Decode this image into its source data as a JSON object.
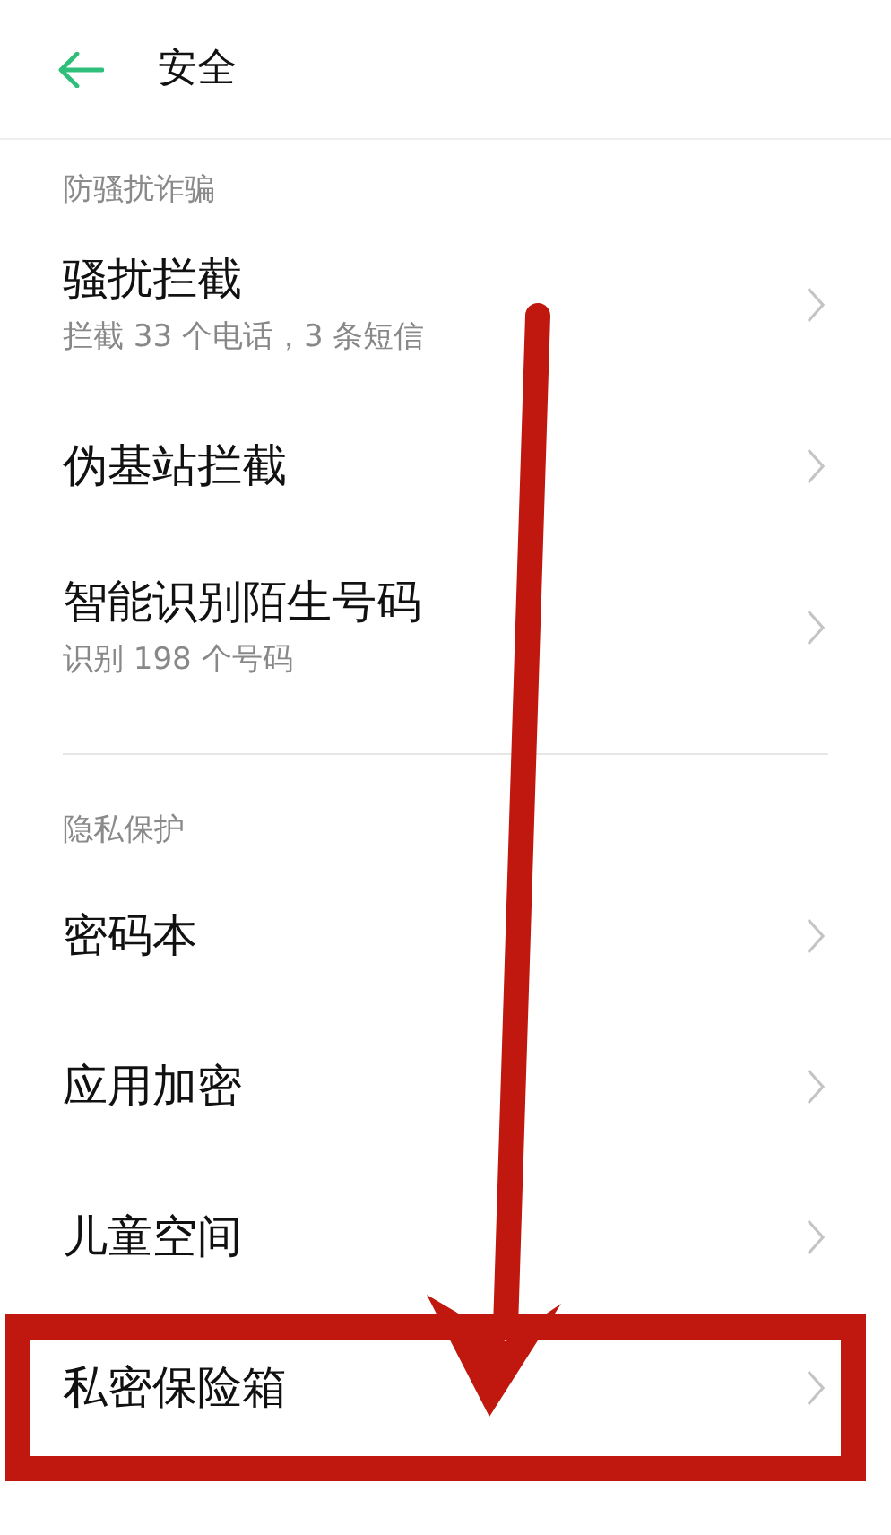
{
  "header": {
    "title": "安全"
  },
  "sections": [
    {
      "title": "防骚扰诈骗",
      "items": [
        {
          "label": "骚扰拦截",
          "subtitle": "拦截 33 个电话，3 条短信",
          "highlighted": false
        },
        {
          "label": "伪基站拦截",
          "highlighted": false
        },
        {
          "label": "智能识别陌生号码",
          "subtitle": "识别 198 个号码",
          "highlighted": false
        }
      ]
    },
    {
      "title": "隐私保护",
      "items": [
        {
          "label": "密码本",
          "highlighted": false
        },
        {
          "label": "应用加密",
          "highlighted": false
        },
        {
          "label": "儿童空间",
          "highlighted": false
        },
        {
          "label": "私密保险箱",
          "highlighted": true
        }
      ]
    }
  ]
}
